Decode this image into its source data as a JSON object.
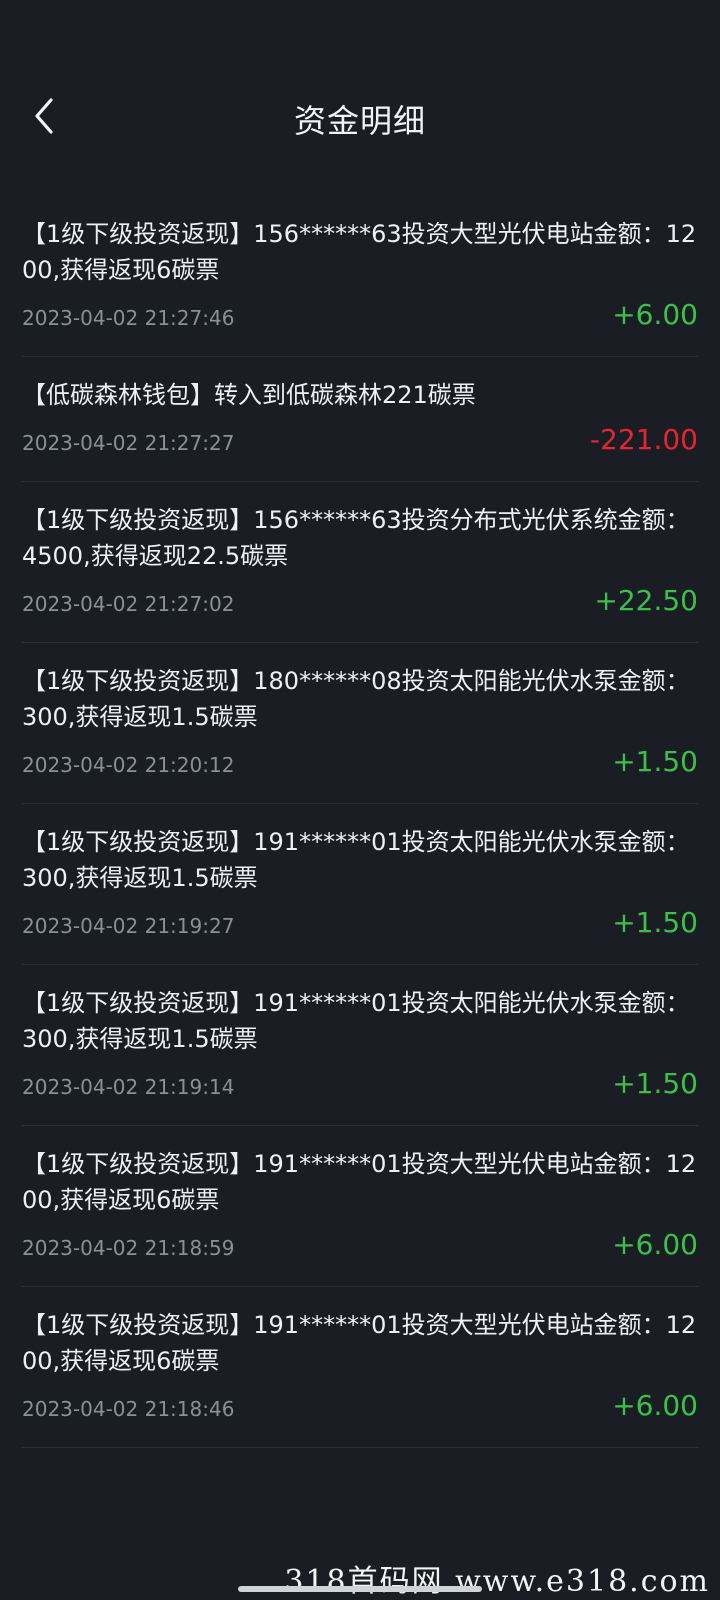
{
  "header": {
    "title": "资金明细"
  },
  "colors": {
    "positive": "#3cc148",
    "negative": "#e8252f",
    "background": "#1a1d24"
  },
  "items": [
    {
      "description": "【1级下级投资返现】156******63投资大型光伏电站金额：1200,获得返现6碳票",
      "time": "2023-04-02 21:27:46",
      "amount": "+6.00",
      "sign": "positive"
    },
    {
      "description": "【低碳森林钱包】转入到低碳森林221碳票",
      "time": "2023-04-02 21:27:27",
      "amount": "-221.00",
      "sign": "negative"
    },
    {
      "description": "【1级下级投资返现】156******63投资分布式光伏系统金额：4500,获得返现22.5碳票",
      "time": "2023-04-02 21:27:02",
      "amount": "+22.50",
      "sign": "positive"
    },
    {
      "description": "【1级下级投资返现】180******08投资太阳能光伏水泵金额：300,获得返现1.5碳票",
      "time": "2023-04-02 21:20:12",
      "amount": "+1.50",
      "sign": "positive"
    },
    {
      "description": "【1级下级投资返现】191******01投资太阳能光伏水泵金额：300,获得返现1.5碳票",
      "time": "2023-04-02 21:19:27",
      "amount": "+1.50",
      "sign": "positive"
    },
    {
      "description": "【1级下级投资返现】191******01投资太阳能光伏水泵金额：300,获得返现1.5碳票",
      "time": "2023-04-02 21:19:14",
      "amount": "+1.50",
      "sign": "positive"
    },
    {
      "description": "【1级下级投资返现】191******01投资大型光伏电站金额：1200,获得返现6碳票",
      "time": "2023-04-02 21:18:59",
      "amount": "+6.00",
      "sign": "positive"
    },
    {
      "description": "【1级下级投资返现】191******01投资大型光伏电站金额：1200,获得返现6碳票",
      "time": "2023-04-02 21:18:46",
      "amount": "+6.00",
      "sign": "positive"
    }
  ],
  "watermark": "318首码网 www.e318.com"
}
